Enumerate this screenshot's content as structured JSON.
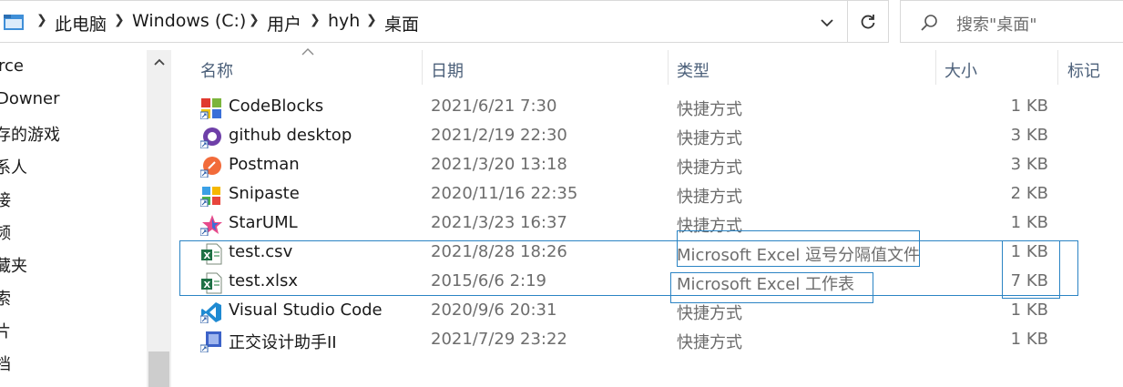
{
  "address_bar": {
    "breadcrumbs": [
      "此电脑",
      "Windows (C:)",
      "用户",
      "hyh",
      "桌面"
    ]
  },
  "search": {
    "placeholder": "搜索\"桌面\""
  },
  "nav_pane": {
    "items": [
      "rce",
      "Downer",
      "存的游戏",
      "系人",
      "接",
      "频",
      "藏夹",
      "索",
      "片",
      "档"
    ]
  },
  "columns": {
    "name": "名称",
    "date": "日期",
    "type": "类型",
    "size": "大小",
    "tags": "标记"
  },
  "files": [
    {
      "name": "CodeBlocks",
      "date": "2021/6/21 7:30",
      "type": "快捷方式",
      "size": "1 KB",
      "icon": "codeblocks-icon"
    },
    {
      "name": "github desktop",
      "date": "2021/2/19 22:30",
      "type": "快捷方式",
      "size": "3 KB",
      "icon": "github-desktop-icon"
    },
    {
      "name": "Postman",
      "date": "2021/3/20 13:18",
      "type": "快捷方式",
      "size": "3 KB",
      "icon": "postman-icon"
    },
    {
      "name": "Snipaste",
      "date": "2020/11/16 22:35",
      "type": "快捷方式",
      "size": "2 KB",
      "icon": "snipaste-icon"
    },
    {
      "name": "StarUML",
      "date": "2021/3/23 16:37",
      "type": "快捷方式",
      "size": "1 KB",
      "icon": "staruml-icon"
    },
    {
      "name": "test.csv",
      "date": "2021/8/28 18:26",
      "type": "Microsoft Excel 逗号分隔值文件",
      "size": "1 KB",
      "icon": "excel-csv-icon"
    },
    {
      "name": "test.xlsx",
      "date": "2015/6/6 2:19",
      "type": "Microsoft Excel 工作表",
      "size": "7 KB",
      "icon": "excel-xlsx-icon"
    },
    {
      "name": "Visual Studio Code",
      "date": "2020/9/6 20:31",
      "type": "快捷方式",
      "size": "1 KB",
      "icon": "vscode-icon"
    },
    {
      "name": "正交设计助手II",
      "date": "2021/7/29 23:22",
      "type": "快捷方式",
      "size": "1 KB",
      "icon": "shortcut-app-icon"
    }
  ],
  "colors": {
    "header_text": "#4c607a",
    "annotation": "#2b84c4",
    "secondary_text": "#6d6d6d"
  }
}
